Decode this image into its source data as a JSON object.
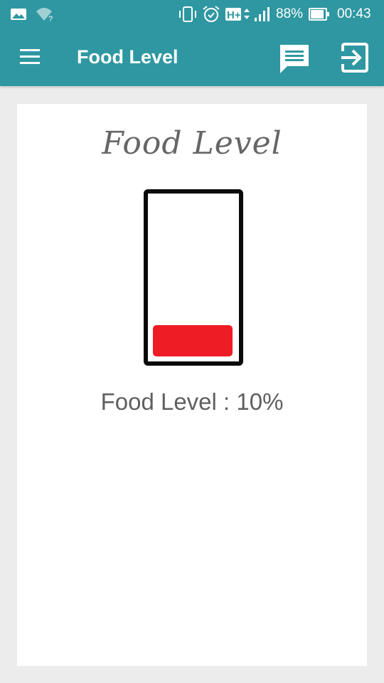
{
  "status_bar": {
    "battery_percent": "88%",
    "time": "00:43",
    "network": "H+",
    "icons": [
      "gallery-icon",
      "wifi-unknown-icon",
      "vibrate-icon",
      "alarm-icon",
      "network-type-icon",
      "signal-icon",
      "battery-icon"
    ]
  },
  "app_bar": {
    "title": "Food Level",
    "icons": [
      "menu-icon",
      "chat-icon",
      "logout-icon"
    ]
  },
  "card": {
    "heading": "Food Level",
    "level_label": "Food Level : 10%",
    "level_fraction": 0.2,
    "fill_color": "#ee1c25"
  },
  "colors": {
    "primary": "#2f97a1",
    "background": "#ececec",
    "card": "#ffffff",
    "text": "#5f5f5f"
  }
}
